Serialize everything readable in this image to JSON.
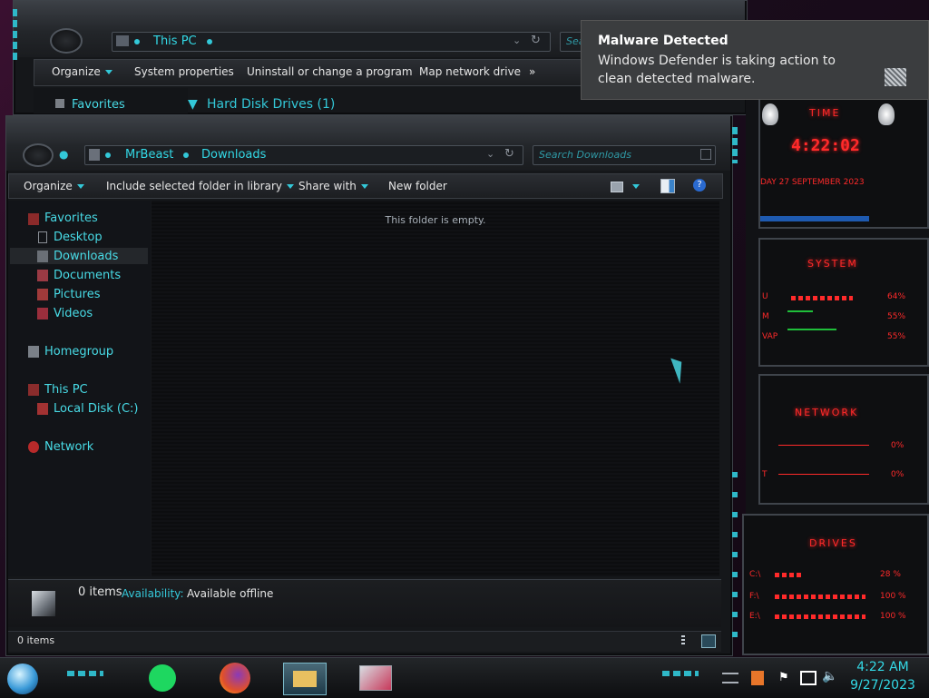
{
  "back_window": {
    "address_location": "This PC",
    "search_placeholder": "Sea",
    "commands": [
      "Organize",
      "System properties",
      "Uninstall or change a program",
      "Map network drive",
      "»"
    ],
    "nav_favorites": "Favorites",
    "group_header": "Hard Disk Drives (1)"
  },
  "explorer": {
    "breadcrumb": [
      "MrBeast",
      "Downloads"
    ],
    "search_placeholder": "Search Downloads",
    "commands": {
      "organize": "Organize",
      "include": "Include selected folder in library",
      "share": "Share with",
      "new_folder": "New folder"
    },
    "nav": {
      "favorites": "Favorites",
      "desktop": "Desktop",
      "downloads": "Downloads",
      "documents": "Documents",
      "pictures": "Pictures",
      "videos": "Videos",
      "homegroup": "Homegroup",
      "this_pc": "This PC",
      "local_disk": "Local Disk (C:)",
      "network": "Network"
    },
    "empty_message": "This folder is empty.",
    "details": {
      "items": "0 items",
      "availability_label": "Availability:",
      "availability_value": "Available offline"
    },
    "status_bar": "0 items"
  },
  "notification": {
    "title": "Malware Detected",
    "body": "Windows Defender is taking action to clean detected malware."
  },
  "gadgets": {
    "time_title": "TIME",
    "time_value": "4:22:02",
    "date_value": "DAY 27 SEPTEMBER 2023",
    "system_title": "SYSTEM",
    "cpu_label": "U",
    "cpu_value": "64%",
    "ram_label": "M",
    "ram_value": "55%",
    "swap_label": "VAP",
    "swap_value": "55%",
    "network_title": "NETWORK",
    "net_in": "0%",
    "net_out": "0%",
    "net_out_label": "T",
    "drives_title": "DRIVES",
    "drives": [
      {
        "label": "C:\\",
        "value": "28 %"
      },
      {
        "label": "F:\\",
        "value": "100 %"
      },
      {
        "label": "E:\\",
        "value": "100 %"
      }
    ]
  },
  "taskbar": {
    "time": "4:22 AM",
    "date": "9/27/2023",
    "icons": [
      "start-orb-icon",
      "spotify-icon",
      "firefox-icon",
      "file-explorer-icon",
      "screen-app-icon"
    ]
  }
}
